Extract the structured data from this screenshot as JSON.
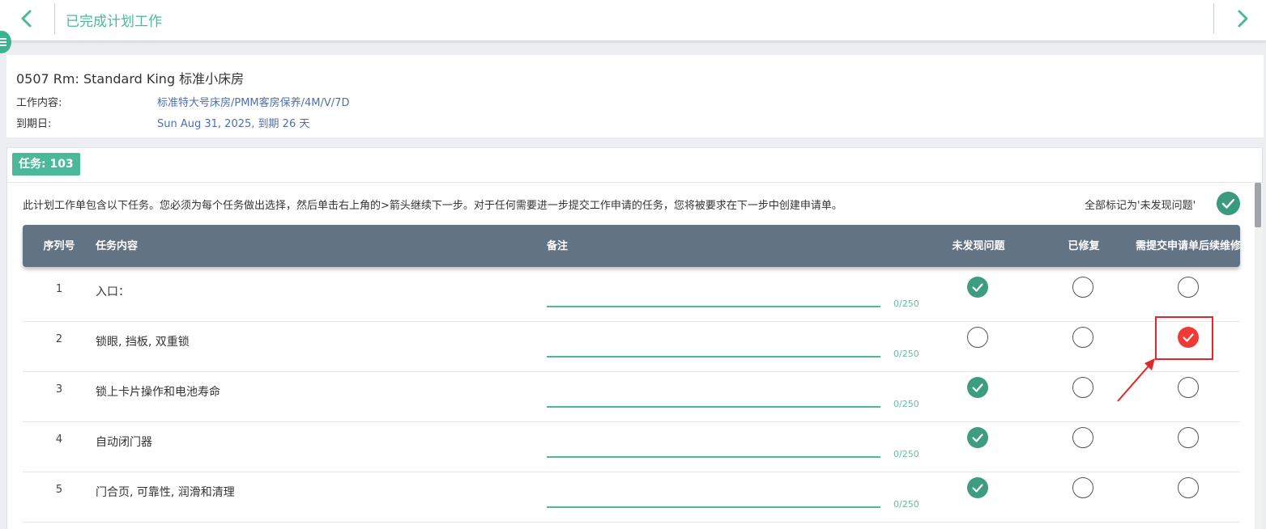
{
  "header": {
    "title": "已完成计划工作",
    "back_icon": "chevron-left-icon",
    "forward_icon": "chevron-right-icon",
    "menu_icon": "menu-icon",
    "accent_color": "#4db89a"
  },
  "info": {
    "room_title": "0507 Rm: Standard King 标准小床房",
    "work_content_label": "工作内容:",
    "work_content_value": "标准特大号床房/PMM客房保养/4M/V/7D",
    "due_date_label": "到期日:",
    "due_date_value": "Sun Aug 31, 2025, 到期 26 天"
  },
  "tasks": {
    "badge": "任务: 103",
    "instructions": "此计划工作单包含以下任务。您必须为每个任务做出选择，然后单击右上角的>箭头继续下一步。对于任何需要进一步提交工作申请的任务，您将被要求在下一步中创建申请单。",
    "mark_all_label": "全部标记为'未发现问题'",
    "columns": {
      "no": "序列号",
      "task": "任务内容",
      "note": "备注",
      "not_found": "未发现问题",
      "repaired": "已修复",
      "request": "需提交申请单后续维修"
    },
    "rows": [
      {
        "no": "1",
        "task": "入口：",
        "note_count": "0/250",
        "selected": "not_found"
      },
      {
        "no": "2",
        "task": "锁眼, 挡板, 双重锁",
        "note_count": "0/250",
        "selected": "request"
      },
      {
        "no": "3",
        "task": "锁上卡片操作和电池寿命",
        "note_count": "0/250",
        "selected": "not_found"
      },
      {
        "no": "4",
        "task": "自动闭门器",
        "note_count": "0/250",
        "selected": "not_found"
      },
      {
        "no": "5",
        "task": "门合页, 可靠性, 润滑和清理",
        "note_count": "0/250",
        "selected": "not_found"
      }
    ]
  },
  "colors": {
    "header_bg": "#627383",
    "check_green": "#3e9d80",
    "check_red": "#f03a36",
    "annotation_red": "#e0282b"
  }
}
